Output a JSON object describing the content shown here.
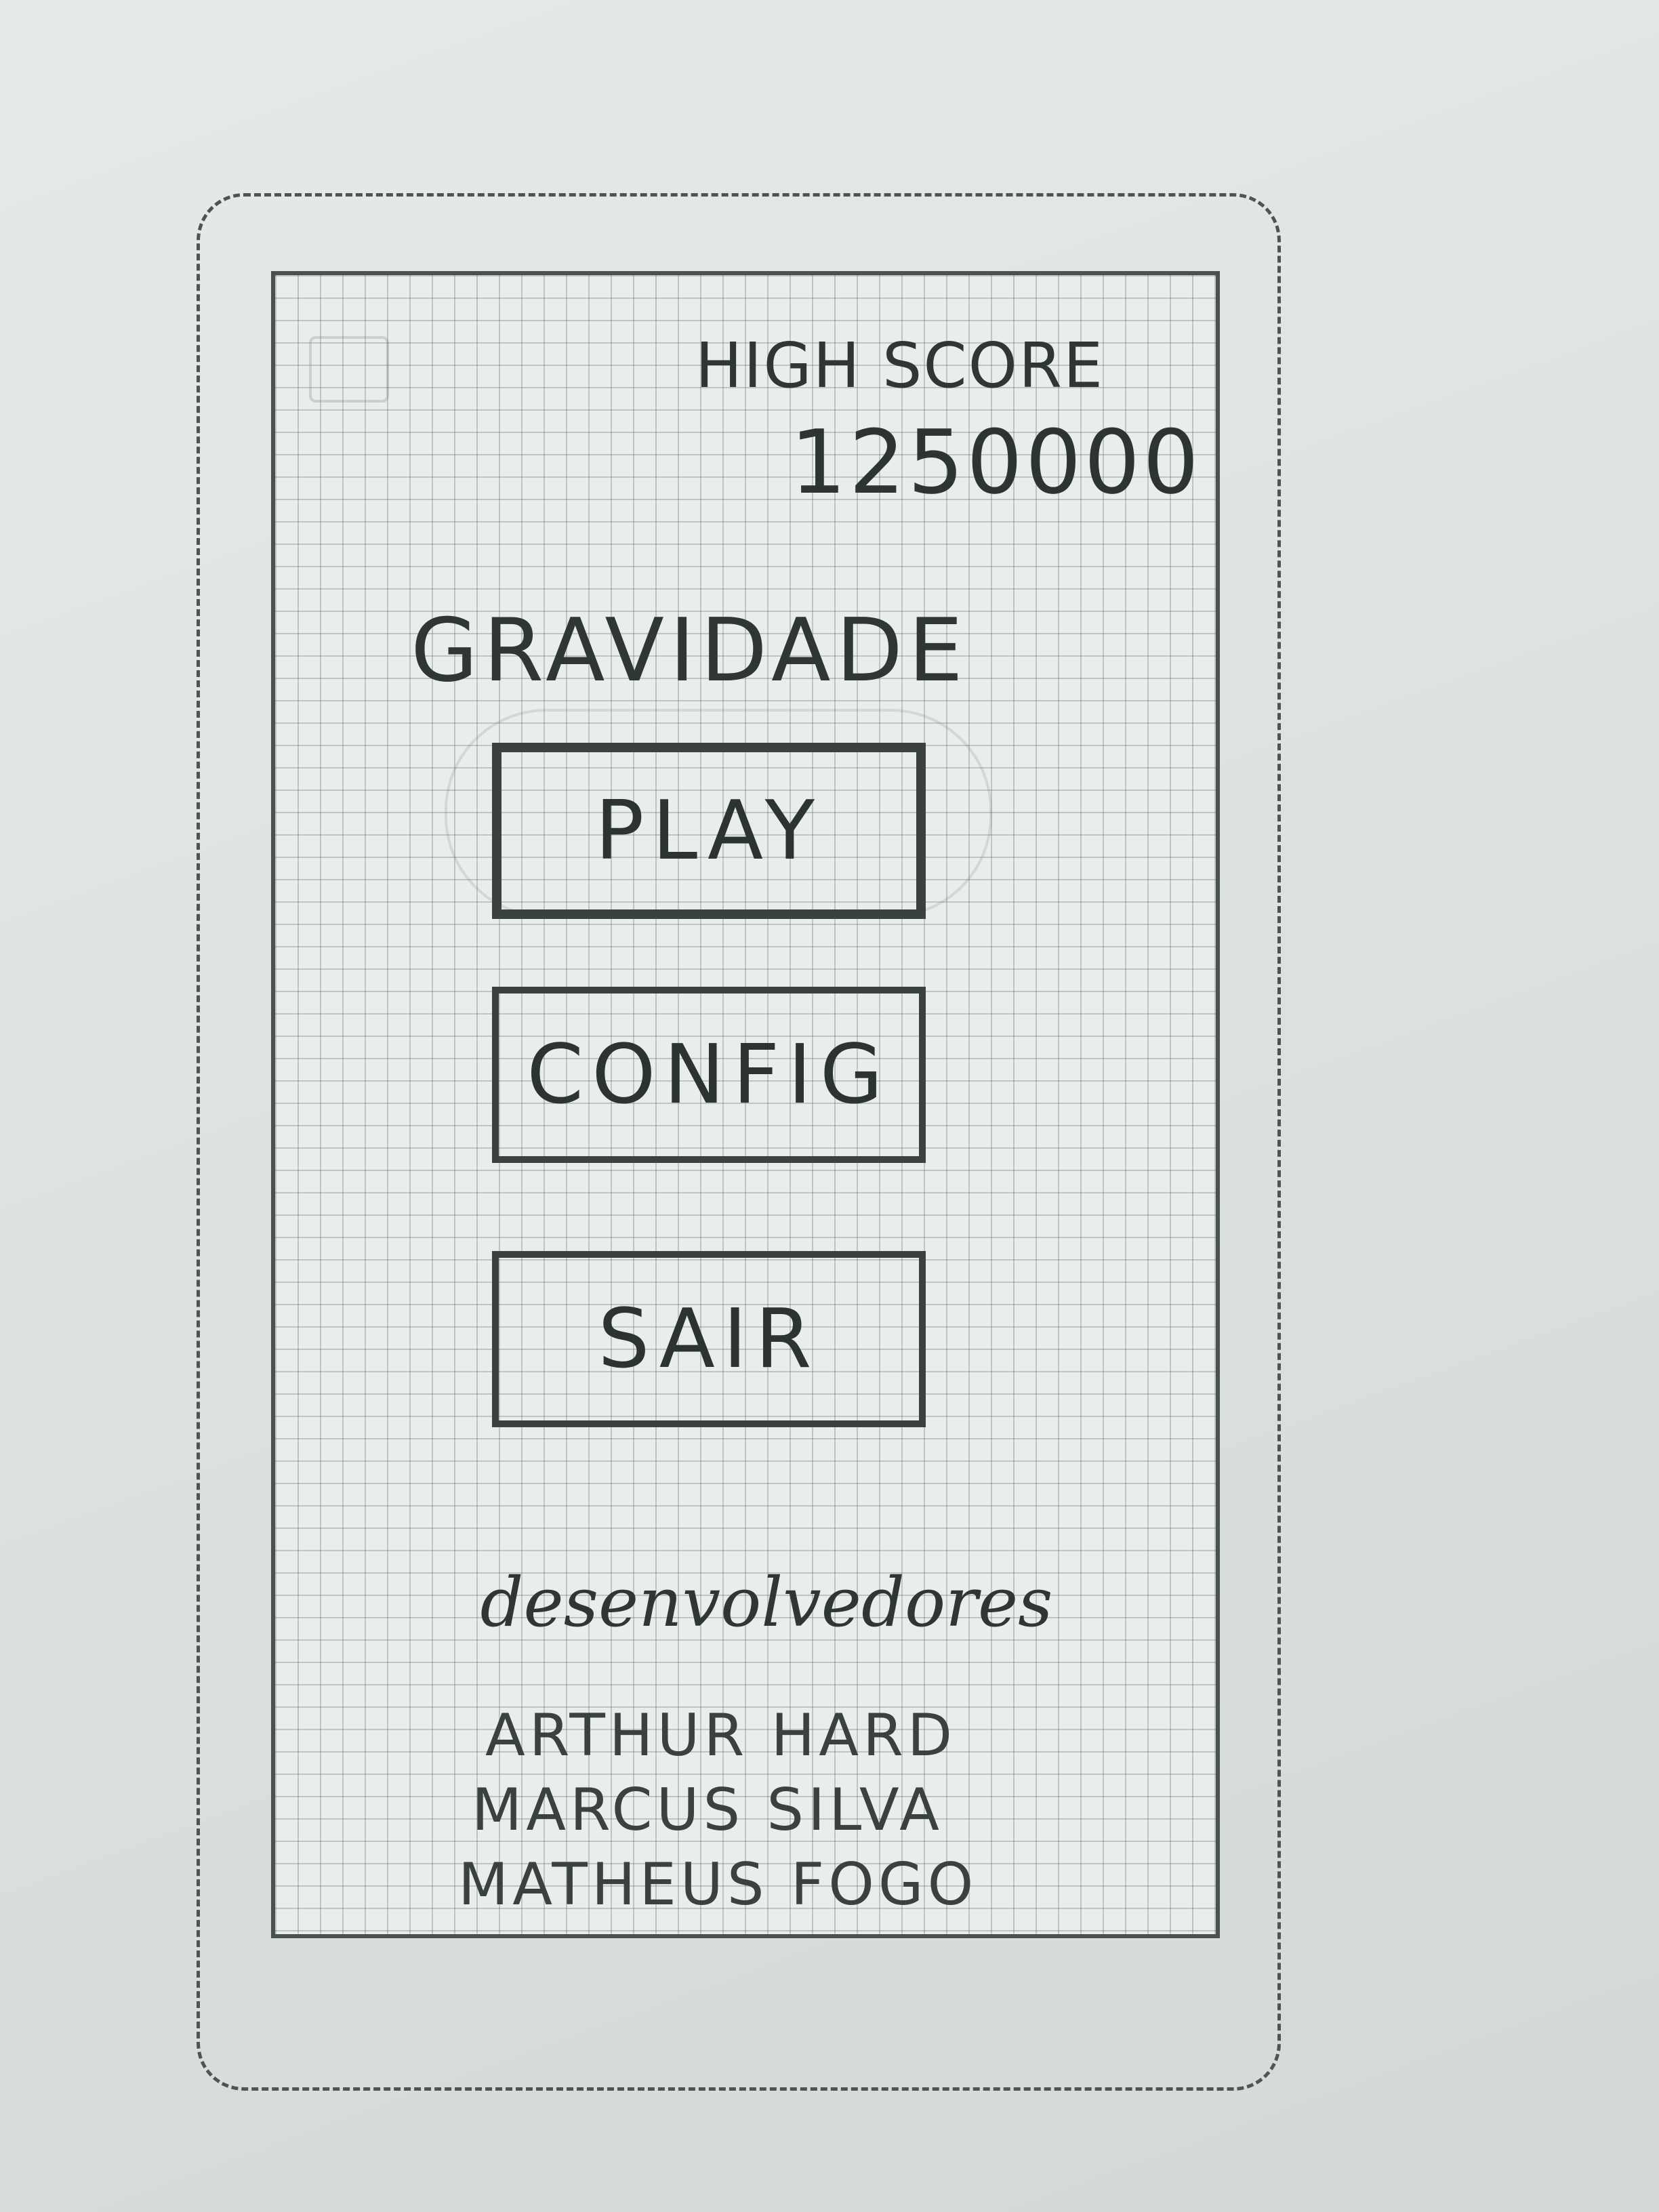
{
  "high_score": {
    "label": "HIGH SCORE",
    "value": "1250000"
  },
  "app_title": "GRAVIDADE",
  "menu": {
    "play_label": "PLAY",
    "config_label": "CONFIG",
    "sair_label": "SAIR"
  },
  "credits": {
    "heading": "desenvolvedores",
    "developers": [
      "ARTHUR HARD",
      "MARCUS SILVA",
      "MATHEUS FOGO"
    ]
  }
}
